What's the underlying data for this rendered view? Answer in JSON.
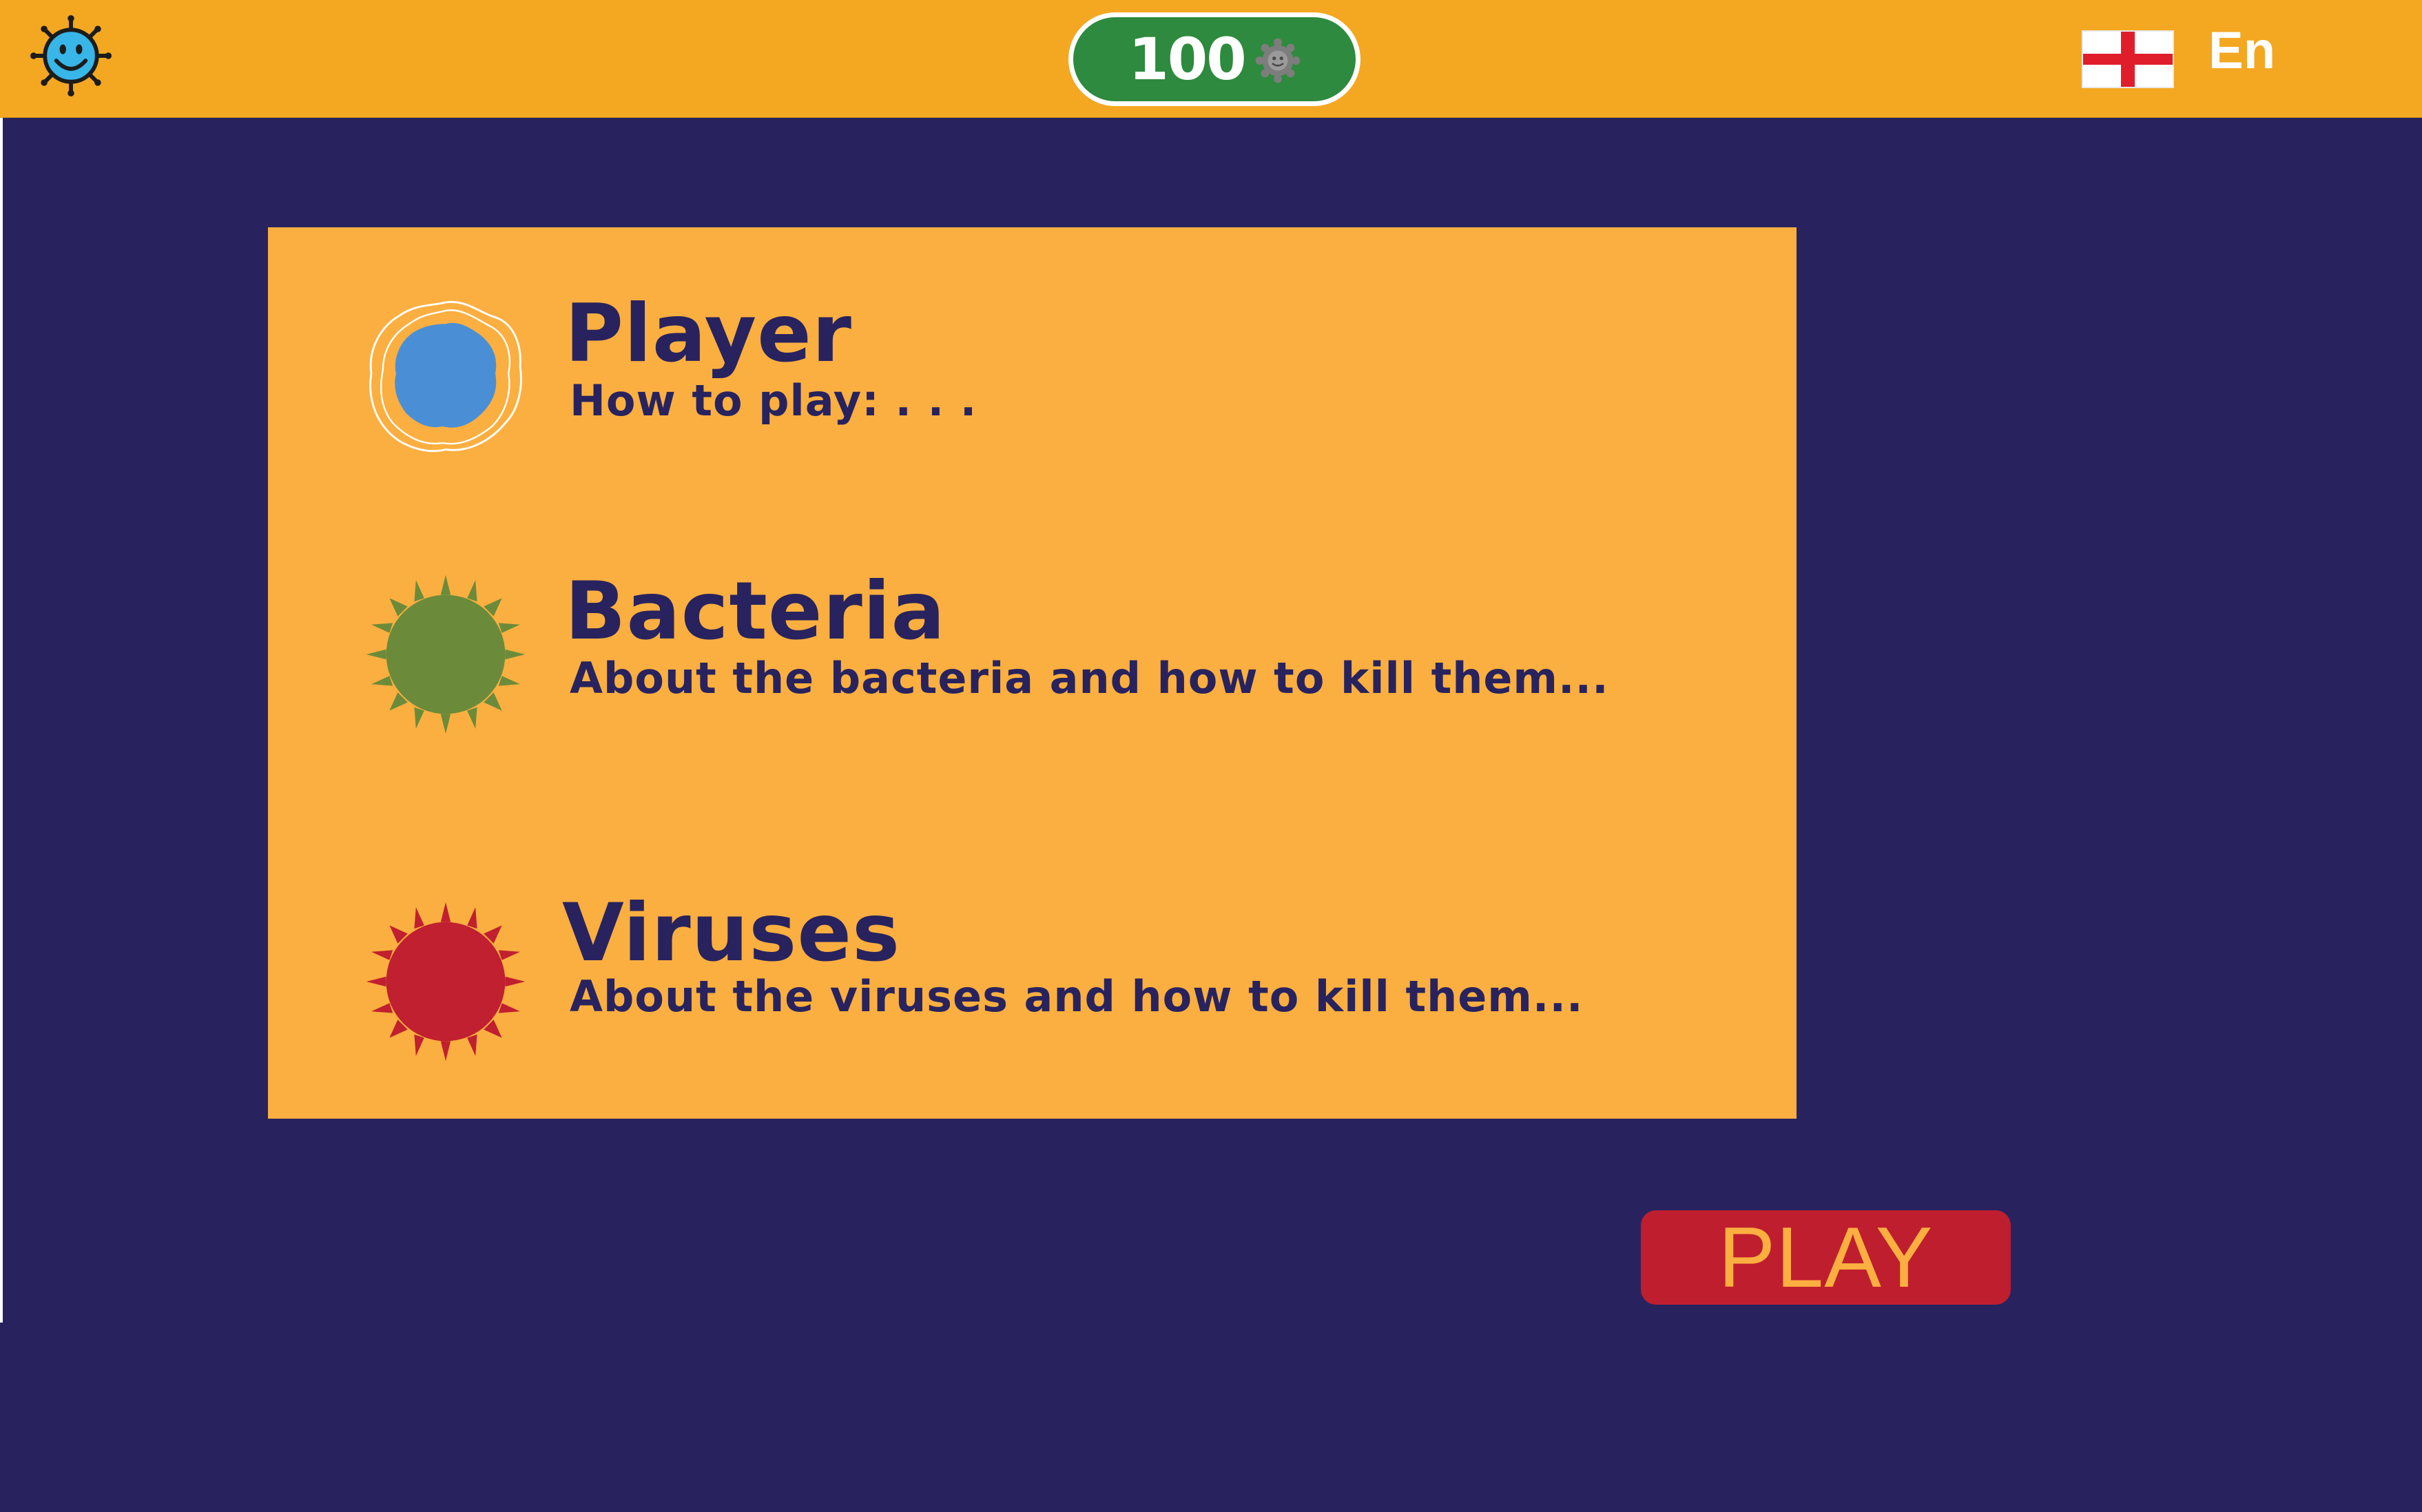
{
  "header": {
    "logo_icon": "smiling-germ-icon",
    "score": "100",
    "score_icon": "gear-germ-icon",
    "language_flag": "england-flag-icon",
    "language": "En"
  },
  "info": {
    "items": [
      {
        "title": "Player",
        "description": "How to play: . . .",
        "icon": "blue-cell-icon",
        "color": "#4a8fd6"
      },
      {
        "title": "Bacteria",
        "description": "About the bacteria and how to kill them...",
        "icon": "green-spiky-bacteria-icon",
        "color": "#6b8b3a"
      },
      {
        "title": "Viruses",
        "description": "About the viruses and how to kill them...",
        "icon": "red-spiky-virus-icon",
        "color": "#c0202f"
      }
    ]
  },
  "play_button": {
    "label": "PLAY"
  },
  "colors": {
    "background": "#28235e",
    "top_bar": "#f4a721",
    "panel": "#fbaf40",
    "score_pill": "#2e8a3e",
    "play_button": "#bf1e2e",
    "play_text": "#fbaf40"
  }
}
